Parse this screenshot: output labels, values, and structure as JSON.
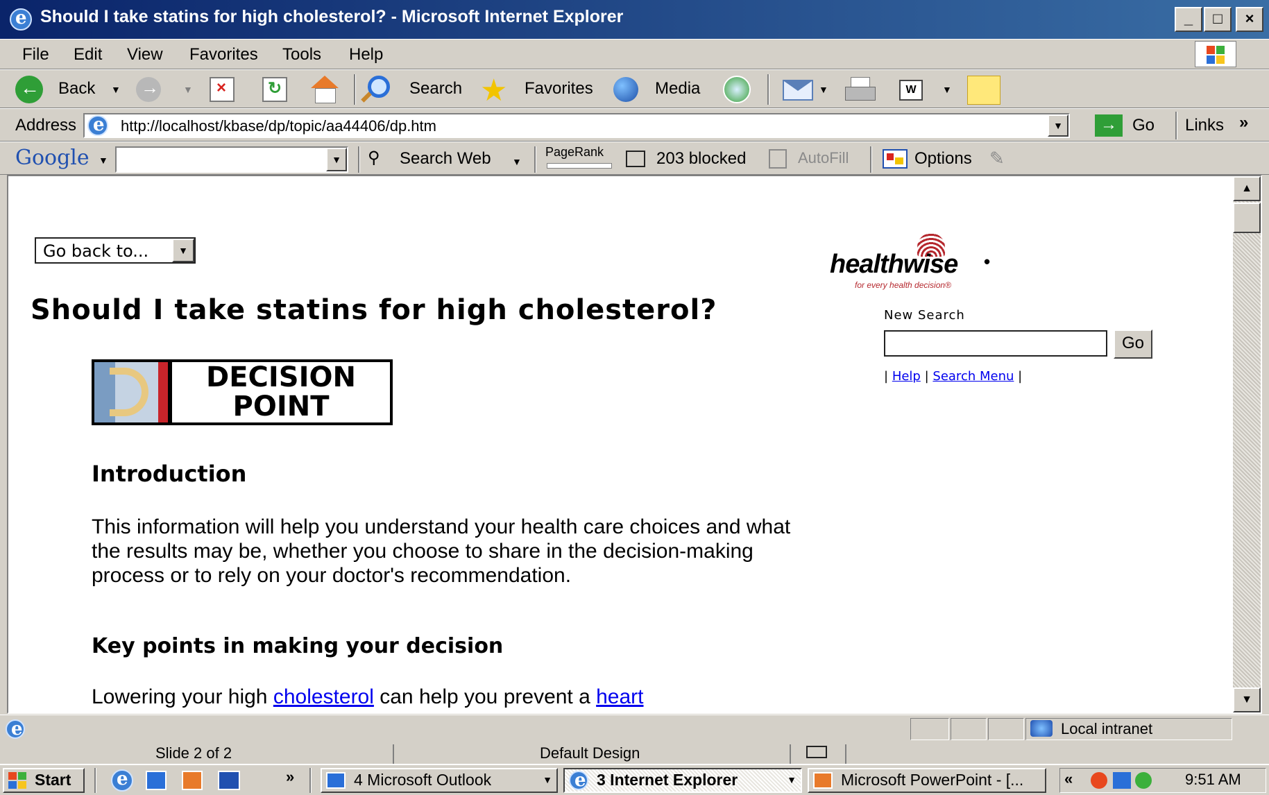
{
  "window": {
    "title": "Should I take statins for high cholesterol? - Microsoft Internet Explorer",
    "min": "_",
    "max": "□",
    "close": "×"
  },
  "menu": [
    "File",
    "Edit",
    "View",
    "Favorites",
    "Tools",
    "Help"
  ],
  "toolbar": {
    "back": "Back",
    "search": "Search",
    "favorites": "Favorites",
    "media": "Media",
    "word_icon": "W"
  },
  "address": {
    "label": "Address",
    "url": "http://localhost/kbase/dp/topic/aa44406/dp.htm",
    "go": "Go",
    "links": "Links",
    "links_more": "»"
  },
  "google_bar": {
    "brand": "Google",
    "search_web": "Search Web",
    "pagerank": "PageRank",
    "blocked": "203 blocked",
    "autofill": "AutoFill",
    "options": "Options"
  },
  "page": {
    "go_back": "Go back to...",
    "heading": "Should I take statins for high cholesterol?",
    "logo_line1": "DECISION",
    "logo_line2": "POINT",
    "intro_heading": "Introduction",
    "intro_text": "This information will help you understand your health care choices and what the results may be, whether you choose to share in the decision-making process or to rely on your doctor's recommendation.",
    "key_heading": "Key points in making your decision",
    "key_text_1": "Lowering your high ",
    "key_link_1": "cholesterol",
    "key_text_2": " can help you prevent a ",
    "key_link_2": "heart"
  },
  "sidebar": {
    "brand": "healthwise",
    "brand_mark": "•",
    "tagline": "for every health decision®",
    "new_search": "New Search",
    "go": "Go",
    "pipe": "|",
    "help": "Help",
    "search_menu": "Search Menu"
  },
  "status": {
    "zone": "Local intranet"
  },
  "ppt_status": {
    "slide": "Slide 2 of 2",
    "design": "Default Design"
  },
  "taskbar": {
    "start": "Start",
    "chevron": "»",
    "outlook": "4 Microsoft Outlook",
    "ie": "3 Internet Explorer",
    "ppt": "Microsoft PowerPoint - [...",
    "tray_chevron": "«",
    "clock": "9:51 AM"
  },
  "colors": {
    "title_start": "#0a246a",
    "title_end": "#3a6ea5",
    "link": "#0000ee",
    "chrome": "#d4d0c8",
    "healthwise_red": "#b5282e"
  }
}
